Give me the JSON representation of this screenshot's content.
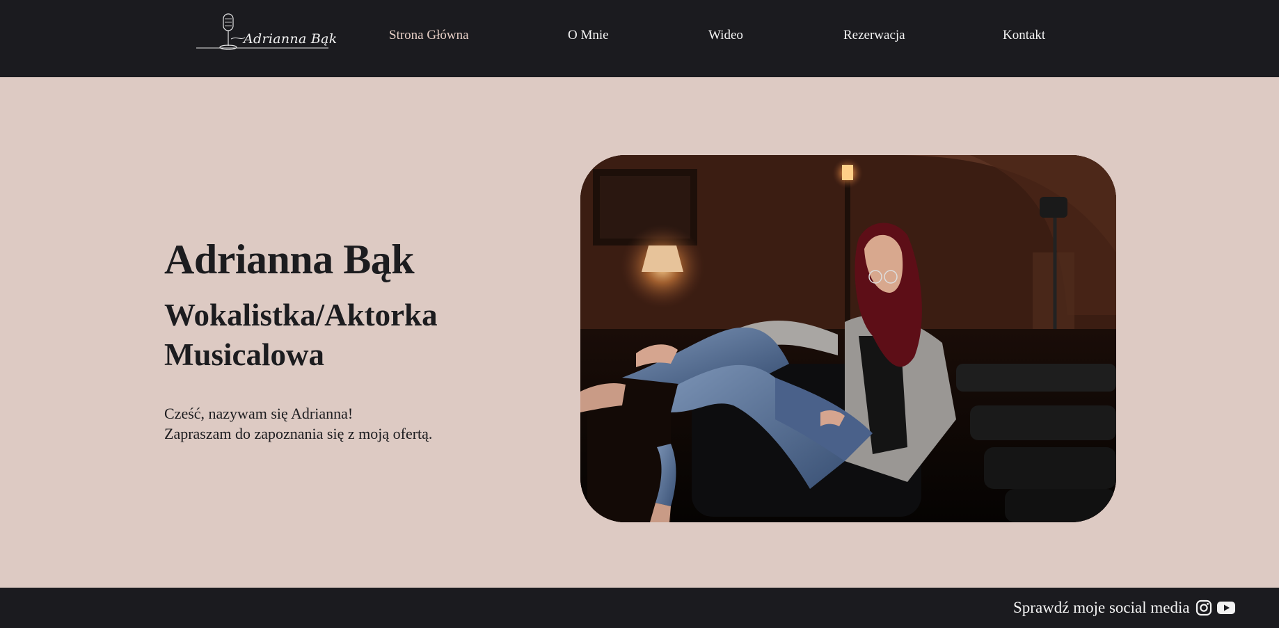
{
  "brand": {
    "logo_text": "Adrianna Bąk",
    "logo_icon": "microphone-icon"
  },
  "nav": {
    "items": [
      {
        "label": "Strona Główna",
        "active": true
      },
      {
        "label": "O Mnie",
        "active": false
      },
      {
        "label": "Wideo",
        "active": false
      },
      {
        "label": "Rezerwacja",
        "active": false
      },
      {
        "label": "Kontakt",
        "active": false
      }
    ]
  },
  "hero": {
    "title": "Adrianna Bąk",
    "subtitle": "Wokalistka/Aktorka Musicalowa",
    "intro_line1": "Cześć, nazywam się Adrianna!",
    "intro_line2": "Zapraszam do zapoznania się z moją ofertą."
  },
  "footer": {
    "social_text": "Sprawdź moje social media",
    "icons": [
      "instagram-icon",
      "youtube-icon"
    ]
  },
  "colors": {
    "header_bg": "#1b1b1f",
    "page_bg": "#ddcac3",
    "nav_active": "#e7cfc6",
    "text_dark": "#1c1c1f",
    "text_light": "#f3f3f3"
  }
}
